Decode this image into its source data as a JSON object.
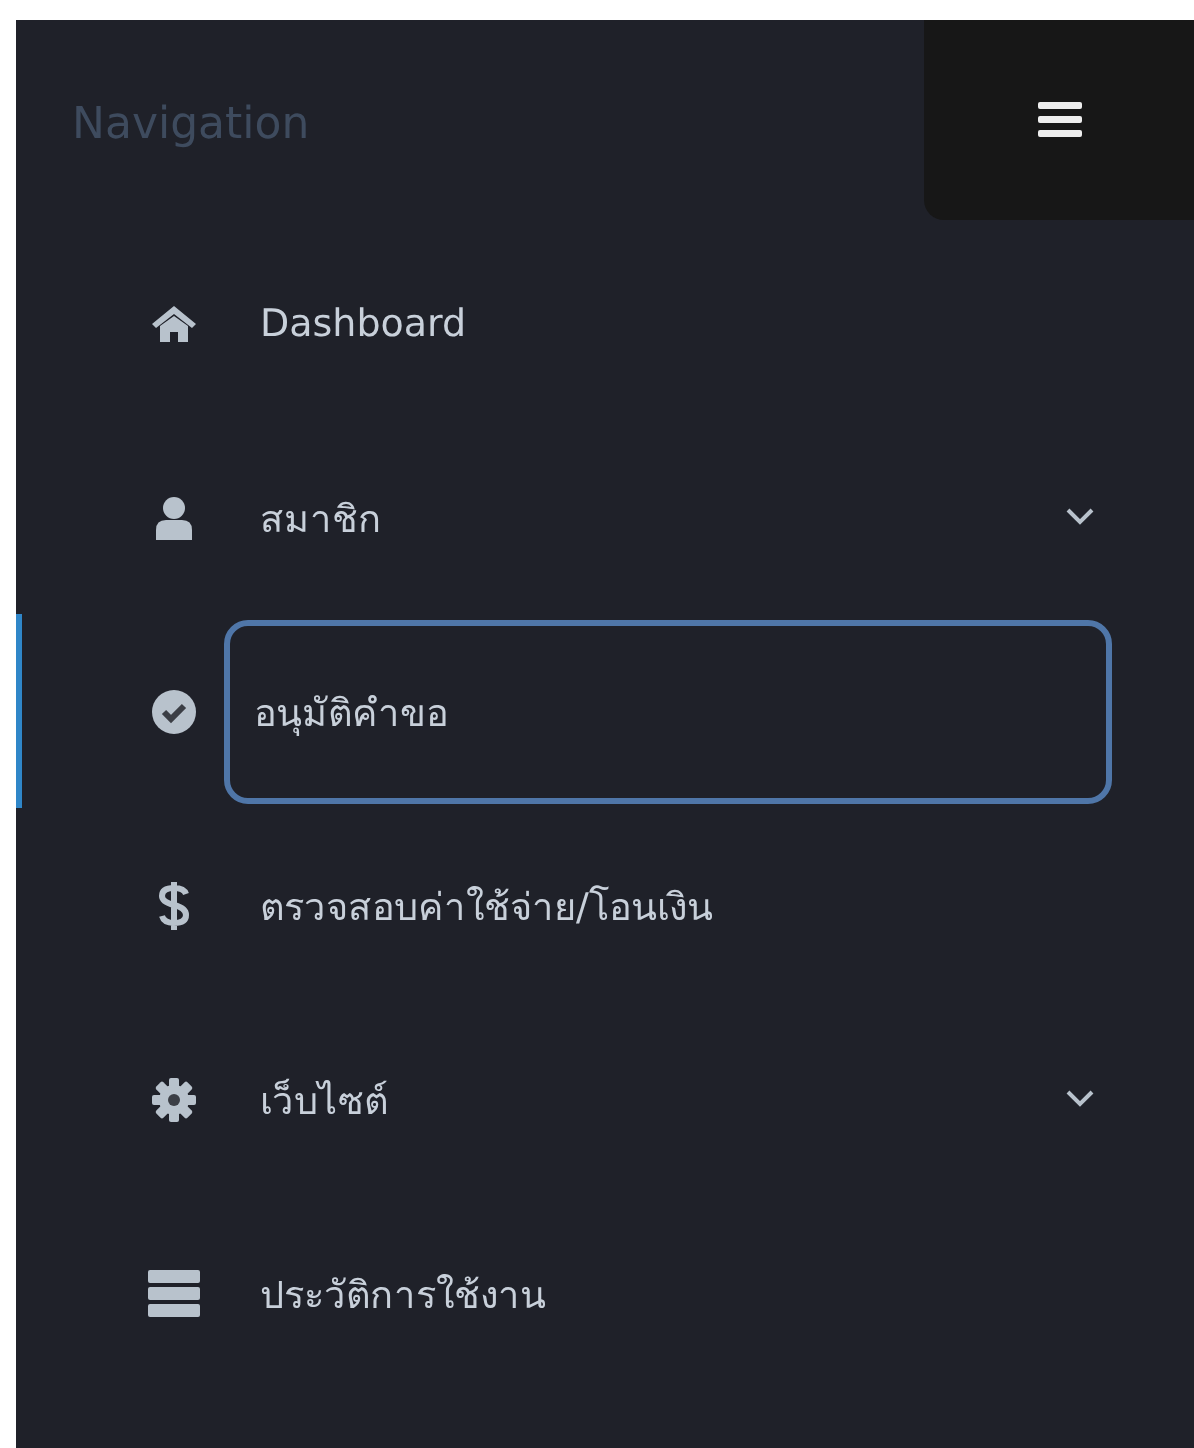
{
  "sidebar": {
    "title": "Navigation",
    "items": [
      {
        "label": "Dashboard",
        "kind": "link",
        "selected": false
      },
      {
        "label": "สมาชิก",
        "kind": "submenu",
        "selected": false
      },
      {
        "label": "อนุมัติคำขอ",
        "kind": "link",
        "selected": true
      },
      {
        "label": "ตรวจสอบค่าใช้จ่าย/โอนเงิน",
        "kind": "link",
        "selected": false
      },
      {
        "label": "เว็บไซต์",
        "kind": "submenu",
        "selected": false
      },
      {
        "label": "ประวัติการใช้งาน",
        "kind": "link",
        "selected": false
      }
    ]
  }
}
